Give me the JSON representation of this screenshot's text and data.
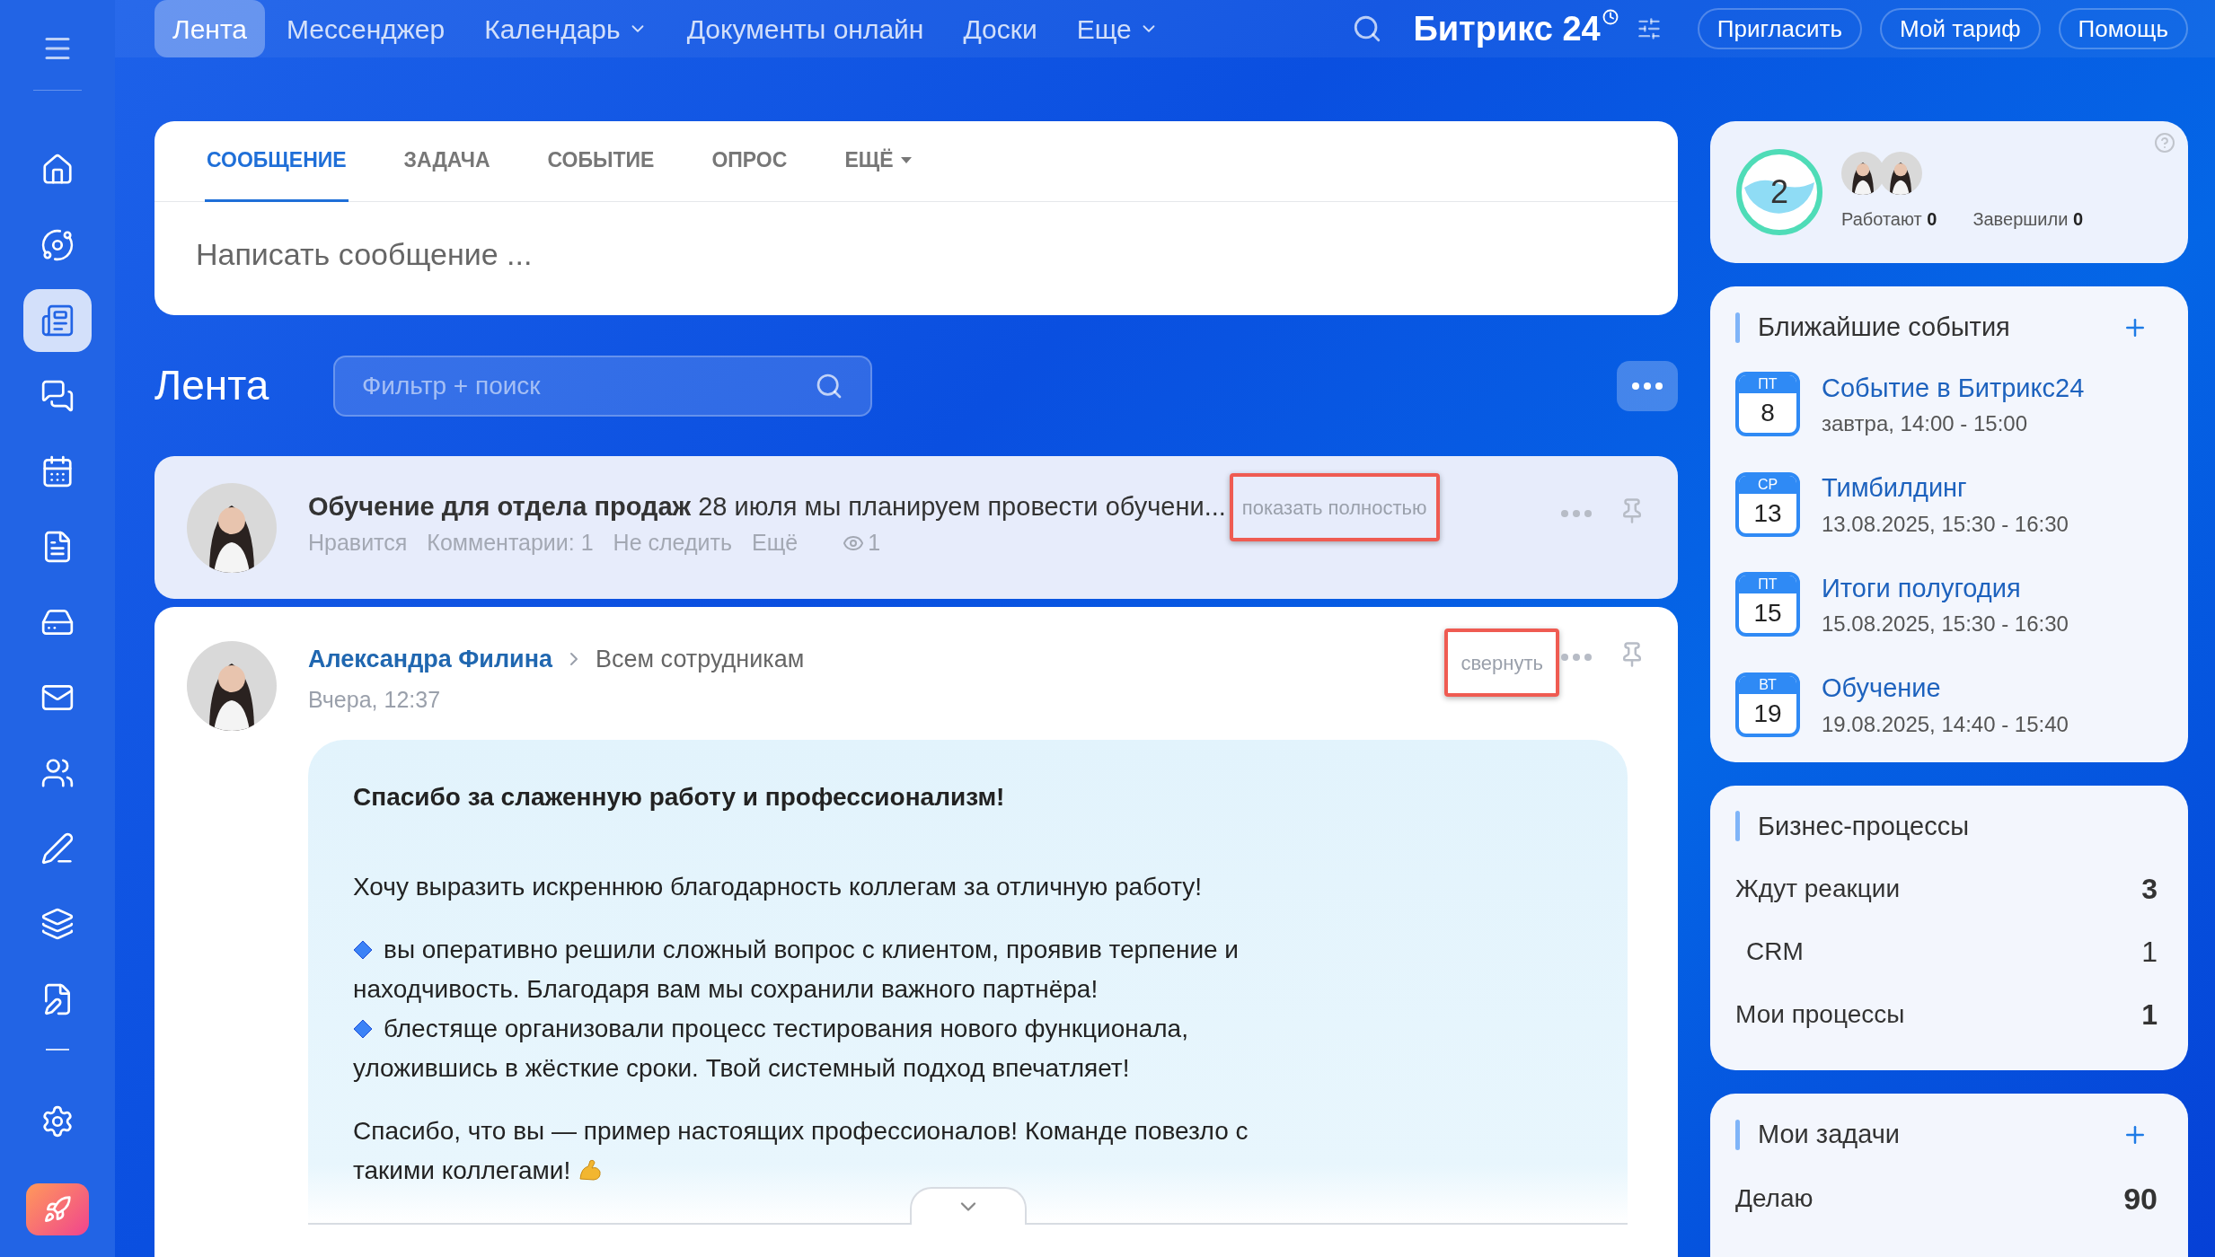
{
  "topbar": {
    "nav": [
      {
        "label": "Лента",
        "selected": true,
        "dropdown": false
      },
      {
        "label": "Мессенджер",
        "selected": false,
        "dropdown": false
      },
      {
        "label": "Календарь",
        "selected": false,
        "dropdown": true
      },
      {
        "label": "Документы онлайн",
        "selected": false,
        "dropdown": false
      },
      {
        "label": "Доски",
        "selected": false,
        "dropdown": false
      },
      {
        "label": "Еще",
        "selected": false,
        "dropdown": true
      }
    ],
    "logo": {
      "name": "Битрикс",
      "number": "24"
    },
    "buttons": [
      "Пригласить",
      "Мой тариф",
      "Помощь"
    ]
  },
  "sidebar": {
    "items": [
      {
        "kind": "home",
        "selected": false
      },
      {
        "kind": "flow",
        "selected": false
      },
      {
        "kind": "feed",
        "selected": true
      },
      {
        "kind": "chat",
        "selected": false
      },
      {
        "kind": "calendar",
        "selected": false
      },
      {
        "kind": "document",
        "selected": false
      },
      {
        "kind": "drive",
        "selected": false
      },
      {
        "kind": "mail",
        "selected": false
      },
      {
        "kind": "users",
        "selected": false
      },
      {
        "kind": "sign",
        "selected": false
      },
      {
        "kind": "layers",
        "selected": false
      },
      {
        "kind": "edit",
        "selected": false
      }
    ]
  },
  "composer": {
    "tabs": [
      {
        "label": "СООБЩЕНИЕ",
        "selected": true,
        "dropdown": false
      },
      {
        "label": "ЗАДАЧА",
        "selected": false,
        "dropdown": false
      },
      {
        "label": "СОБЫТИЕ",
        "selected": false,
        "dropdown": false
      },
      {
        "label": "ОПРОС",
        "selected": false,
        "dropdown": false
      },
      {
        "label": "ЕЩЁ",
        "selected": false,
        "dropdown": true
      }
    ],
    "placeholder": "Написать сообщение ..."
  },
  "feed": {
    "title": "Лента",
    "filter": {
      "placeholder": "Фильтр + поиск"
    }
  },
  "posts": [
    {
      "expanded": false,
      "title": "Обучение для отдела продаж",
      "excerpt": "28 июля мы планируем провести обучени...",
      "toggle": "показать полностью",
      "actions": [
        "Нравится",
        "Комментарии: 1",
        "Не следить",
        "Ещё"
      ],
      "views": "1"
    },
    {
      "expanded": true,
      "author": "Александра Филина",
      "audience": "Всем сотрудникам",
      "date": "Вчера, 12:37",
      "toggle": "свернуть",
      "body": [
        {
          "kind": "heading",
          "text": "Спасибо за слаженную работу и профессионализм!"
        },
        {
          "kind": "para",
          "text": "Хочу выразить искреннюю благодарность коллегам за отличную работу!"
        },
        {
          "kind": "bullet",
          "text": "вы оперативно решили сложный вопрос с клиентом, проявив терпение и находчивость. Благодаря вам мы сохранили важного партнёра!"
        },
        {
          "kind": "bullet",
          "text": "блестяще организовали процесс тестирования нового функционала, уложившись в жёсткие сроки. Твой системный подход впечатляет!"
        },
        {
          "kind": "closing",
          "text": "Спасибо, что вы — пример настоящих профессионалов! Команде повезло с такими коллегами!"
        }
      ]
    }
  ],
  "worktime": {
    "count": "2",
    "stats": [
      {
        "label": "Работают",
        "value": "0"
      },
      {
        "label": "Завершили",
        "value": "0"
      }
    ]
  },
  "events": {
    "title": "Ближайшие события",
    "items": [
      {
        "weekday": "ПТ",
        "day": "8",
        "title": "Событие в Битрикс24",
        "time": "завтра, 14:00 - 15:00"
      },
      {
        "weekday": "СР",
        "day": "13",
        "title": "Тимбилдинг",
        "time": "13.08.2025, 15:30 - 16:30"
      },
      {
        "weekday": "ПТ",
        "day": "15",
        "title": "Итоги полугодия",
        "time": "15.08.2025, 15:30 - 16:30"
      },
      {
        "weekday": "ВТ",
        "day": "19",
        "title": "Обучение",
        "time": "19.08.2025, 14:40 - 15:40"
      }
    ]
  },
  "processes": {
    "title": "Бизнес-процессы",
    "rows": [
      {
        "kind": "group",
        "label": "Ждут реакции",
        "count": "3"
      },
      {
        "kind": "sub",
        "label": "CRM",
        "count": "1"
      },
      {
        "kind": "group",
        "label": "Мои процессы",
        "count": "1"
      }
    ]
  },
  "tasks": {
    "title": "Мои задачи",
    "rows": [
      {
        "label": "Делаю",
        "count": "90"
      }
    ]
  }
}
